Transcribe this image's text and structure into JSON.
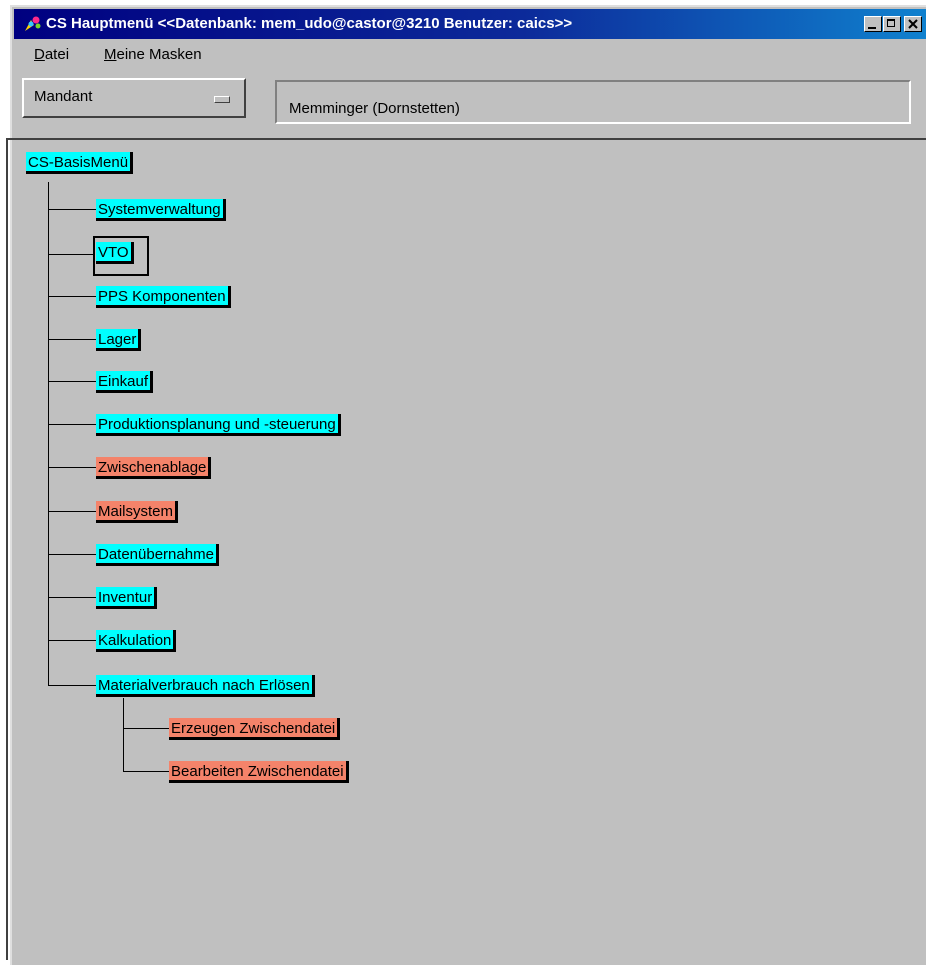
{
  "window": {
    "title": "CS Hauptmenü  <<Datenbank: mem_udo@castor@3210 Benutzer: caics>>"
  },
  "menubar": {
    "items": [
      {
        "label": "atei",
        "mnemonic": "D"
      },
      {
        "label": "eine Masken",
        "mnemonic": "M"
      }
    ]
  },
  "mandant": {
    "button_label": "Mandant",
    "value": "Memminger (Dornstetten)"
  },
  "tree": {
    "root": "CS-BasisMenü",
    "items": [
      {
        "label": "Systemverwaltung",
        "color": "cyan"
      },
      {
        "label": "VTO",
        "color": "cyan",
        "selected": true
      },
      {
        "label": "PPS Komponenten",
        "color": "cyan"
      },
      {
        "label": "Lager",
        "color": "cyan"
      },
      {
        "label": "Einkauf",
        "color": "cyan"
      },
      {
        "label": "Produktionsplanung und -steuerung",
        "color": "cyan"
      },
      {
        "label": "Zwischenablage",
        "color": "salmon"
      },
      {
        "label": "Mailsystem",
        "color": "salmon"
      },
      {
        "label": "Datenübernahme",
        "color": "cyan"
      },
      {
        "label": "Inventur",
        "color": "cyan"
      },
      {
        "label": "Kalkulation",
        "color": "cyan"
      },
      {
        "label": "Materialverbrauch nach Erlösen",
        "color": "cyan"
      }
    ],
    "subitems": [
      {
        "label": "Erzeugen Zwischendatei",
        "color": "salmon"
      },
      {
        "label": "Bearbeiten Zwischendatei",
        "color": "salmon"
      }
    ]
  },
  "colors": {
    "cyan": "#00ffff",
    "salmon": "#f4836a",
    "titlebar": "#000080",
    "face": "#c0c0c0"
  }
}
